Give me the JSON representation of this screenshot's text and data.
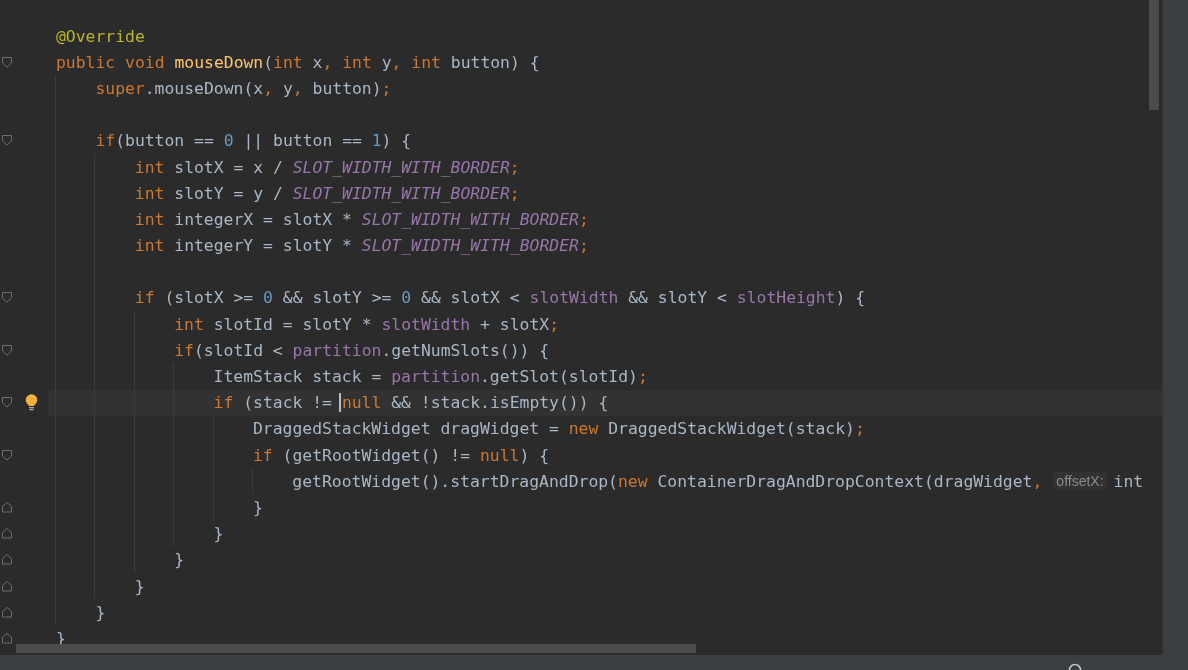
{
  "editor": {
    "lines": [
      {
        "kind": "code",
        "tokens": [
          {
            "text": "@Override",
            "kind": "annot"
          }
        ]
      },
      {
        "kind": "code",
        "expanded": true,
        "tokens": [
          {
            "text": "public void ",
            "kind": "kw"
          },
          {
            "text": "mouseDown",
            "kind": "method"
          },
          {
            "text": "(",
            "kind": "plain"
          },
          {
            "text": "int",
            "kind": "kw"
          },
          {
            "text": " x",
            "kind": "plain"
          },
          {
            "text": ", int",
            "kind": "kw"
          },
          {
            "text": " y",
            "kind": "plain"
          },
          {
            "text": ", int",
            "kind": "kw"
          },
          {
            "text": " button) {",
            "kind": "plain"
          }
        ],
        "children": [
          {
            "kind": "code",
            "tokens": [
              {
                "text": "super",
                "kind": "kw"
              },
              {
                "text": ".mouseDown(x",
                "kind": "plain"
              },
              {
                "text": ",",
                "kind": "kw"
              },
              {
                "text": " y",
                "kind": "plain"
              },
              {
                "text": ",",
                "kind": "kw"
              },
              {
                "text": " button)",
                "kind": "plain"
              },
              {
                "text": ";",
                "kind": "kw"
              }
            ]
          },
          {
            "kind": "blank"
          },
          {
            "kind": "code",
            "expanded": true,
            "tokens": [
              {
                "text": "if",
                "kind": "kw"
              },
              {
                "text": "(button == ",
                "kind": "plain"
              },
              {
                "text": "0",
                "kind": "num"
              },
              {
                "text": " || button == ",
                "kind": "plain"
              },
              {
                "text": "1",
                "kind": "num"
              },
              {
                "text": ") {",
                "kind": "plain"
              }
            ],
            "children": [
              {
                "kind": "code",
                "tokens": [
                  {
                    "text": "int",
                    "kind": "kw"
                  },
                  {
                    "text": " slotX = x / ",
                    "kind": "plain"
                  },
                  {
                    "text": "SLOT_WIDTH_WITH_BORDER",
                    "kind": "const"
                  },
                  {
                    "text": ";",
                    "kind": "kw"
                  }
                ]
              },
              {
                "kind": "code",
                "tokens": [
                  {
                    "text": "int",
                    "kind": "kw"
                  },
                  {
                    "text": " slotY = y / ",
                    "kind": "plain"
                  },
                  {
                    "text": "SLOT_WIDTH_WITH_BORDER",
                    "kind": "const"
                  },
                  {
                    "text": ";",
                    "kind": "kw"
                  }
                ]
              },
              {
                "kind": "code",
                "tokens": [
                  {
                    "text": "int",
                    "kind": "kw"
                  },
                  {
                    "text": " integerX = slotX * ",
                    "kind": "plain"
                  },
                  {
                    "text": "SLOT_WIDTH_WITH_BORDER",
                    "kind": "const"
                  },
                  {
                    "text": ";",
                    "kind": "kw"
                  }
                ]
              },
              {
                "kind": "code",
                "tokens": [
                  {
                    "text": "int",
                    "kind": "kw"
                  },
                  {
                    "text": " integerY = slotY * ",
                    "kind": "plain"
                  },
                  {
                    "text": "SLOT_WIDTH_WITH_BORDER",
                    "kind": "const"
                  },
                  {
                    "text": ";",
                    "kind": "kw"
                  }
                ]
              },
              {
                "kind": "blank"
              },
              {
                "kind": "code",
                "expanded": true,
                "tokens": [
                  {
                    "text": "if",
                    "kind": "kw"
                  },
                  {
                    "text": " (slotX >= ",
                    "kind": "plain"
                  },
                  {
                    "text": "0",
                    "kind": "num"
                  },
                  {
                    "text": " && slotY >= ",
                    "kind": "plain"
                  },
                  {
                    "text": "0",
                    "kind": "num"
                  },
                  {
                    "text": " && slotX < ",
                    "kind": "plain"
                  },
                  {
                    "text": "slotWidth",
                    "kind": "field"
                  },
                  {
                    "text": " && slotY < ",
                    "kind": "plain"
                  },
                  {
                    "text": "slotHeight",
                    "kind": "field"
                  },
                  {
                    "text": ") {",
                    "kind": "plain"
                  }
                ],
                "children": [
                  {
                    "kind": "code",
                    "tokens": [
                      {
                        "text": "int",
                        "kind": "kw"
                      },
                      {
                        "text": " slotId = slotY * ",
                        "kind": "plain"
                      },
                      {
                        "text": "slotWidth",
                        "kind": "field"
                      },
                      {
                        "text": " + slotX",
                        "kind": "plain"
                      },
                      {
                        "text": ";",
                        "kind": "kw"
                      }
                    ]
                  },
                  {
                    "kind": "code",
                    "expanded": true,
                    "tokens": [
                      {
                        "text": "if",
                        "kind": "kw"
                      },
                      {
                        "text": "(slotId < ",
                        "kind": "plain"
                      },
                      {
                        "text": "partition",
                        "kind": "field"
                      },
                      {
                        "text": ".getNumSlots()) {",
                        "kind": "plain"
                      }
                    ],
                    "children": [
                      {
                        "kind": "code",
                        "tokens": [
                          {
                            "text": "ItemStack stack = ",
                            "kind": "plain"
                          },
                          {
                            "text": "partition",
                            "kind": "field"
                          },
                          {
                            "text": ".getSlot(slotId)",
                            "kind": "plain"
                          },
                          {
                            "text": ";",
                            "kind": "kw"
                          }
                        ]
                      },
                      {
                        "kind": "code",
                        "expanded": true,
                        "current": true,
                        "bulb": true,
                        "tokens": [
                          {
                            "text": "if",
                            "kind": "kw"
                          },
                          {
                            "text": " (stack != ",
                            "kind": "plain"
                          },
                          {
                            "text": "null",
                            "kind": "kw",
                            "caret": true
                          },
                          {
                            "text": " && !stack.isEmpty()) {",
                            "kind": "plain"
                          }
                        ],
                        "children": [
                          {
                            "kind": "code",
                            "tokens": [
                              {
                                "text": "DraggedStackWidget dragWidget = ",
                                "kind": "plain"
                              },
                              {
                                "text": "new",
                                "kind": "kw"
                              },
                              {
                                "text": " DraggedStackWidget(stack)",
                                "kind": "plain"
                              },
                              {
                                "text": ";",
                                "kind": "kw"
                              }
                            ]
                          },
                          {
                            "kind": "code",
                            "expanded": true,
                            "tokens": [
                              {
                                "text": "if",
                                "kind": "kw"
                              },
                              {
                                "text": " (getRootWidget() != ",
                                "kind": "plain"
                              },
                              {
                                "text": "null",
                                "kind": "kw"
                              },
                              {
                                "text": ") {",
                                "kind": "plain"
                              }
                            ],
                            "children": [
                              {
                                "kind": "code",
                                "tokens": [
                                  {
                                    "text": "getRootWidget().startDragAndDrop(",
                                    "kind": "plain"
                                  },
                                  {
                                    "text": "new",
                                    "kind": "kw"
                                  },
                                  {
                                    "text": " ContainerDragAndDropContext(dragWidget",
                                    "kind": "plain"
                                  },
                                  {
                                    "text": ",",
                                    "kind": "kw"
                                  },
                                  {
                                    "text": "offsetX:",
                                    "kind": "hint"
                                  },
                                  {
                                    "text": "int",
                                    "kind": "plain"
                                  }
                                ]
                              }
                            ]
                          },
                          {
                            "kind": "code",
                            "fold_end": true,
                            "tokens": [
                              {
                                "text": "}",
                                "kind": "plain"
                              }
                            ]
                          }
                        ]
                      },
                      {
                        "kind": "code",
                        "fold_end": true,
                        "tokens": [
                          {
                            "text": "}",
                            "kind": "plain"
                          }
                        ]
                      }
                    ]
                  },
                  {
                    "kind": "code",
                    "fold_end": true,
                    "tokens": [
                      {
                        "text": "}",
                        "kind": "plain"
                      }
                    ]
                  }
                ]
              },
              {
                "kind": "code",
                "fold_end": true,
                "tokens": [
                  {
                    "text": "}",
                    "kind": "plain"
                  }
                ]
              }
            ]
          },
          {
            "kind": "code",
            "fold_end": true,
            "tokens": [
              {
                "text": "}",
                "kind": "plain"
              }
            ]
          }
        ]
      },
      {
        "kind": "code",
        "fold_end": true,
        "tokens": [
          {
            "text": "}",
            "kind": "plain"
          }
        ]
      }
    ]
  }
}
